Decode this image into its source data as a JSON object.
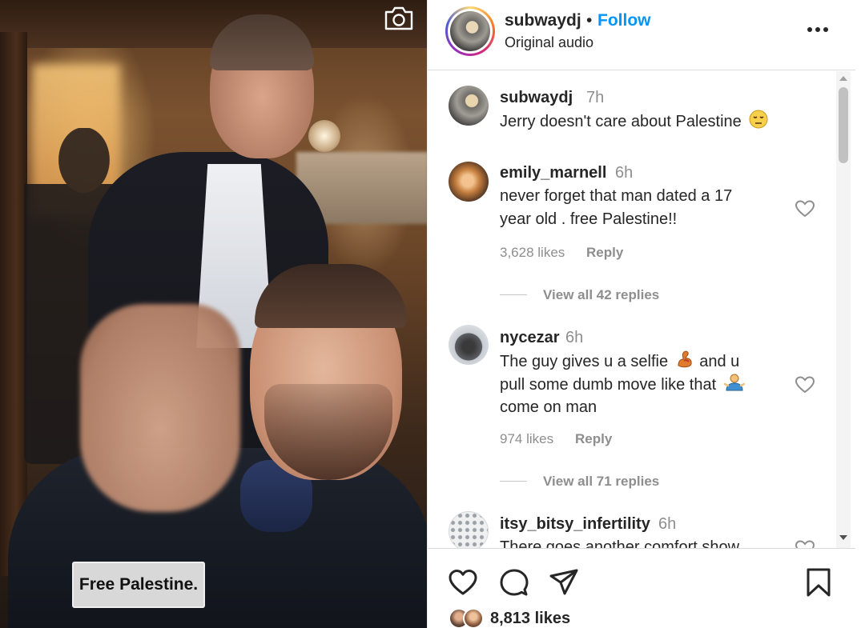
{
  "media": {
    "caption_overlay": "Free Palestine.",
    "icons": {
      "camera": "camera-icon"
    }
  },
  "header": {
    "username": "subwaydj",
    "separator": "•",
    "follow_label": "Follow",
    "audio_label": "Original audio",
    "icons": {
      "more": "more-horizontal-icon"
    }
  },
  "comments": [
    {
      "username": "subwaydj",
      "time": "7h",
      "lines": [
        "Jerry doesn't care about Palestine"
      ],
      "emoji": "downcast-face-icon"
    },
    {
      "username": "emily_marnell",
      "time": "6h",
      "lines": [
        "never forget that man dated a 17",
        "year old . free Palestine!!"
      ],
      "likes": "3,628 likes",
      "reply_label": "Reply",
      "view_replies": "View all 42 replies"
    },
    {
      "username": "nycezar",
      "time": "6h",
      "lines": [
        "The guy gives u a selfie",
        "and u",
        "pull some dumb move like that",
        "come on man"
      ],
      "likes": "974 likes",
      "reply_label": "Reply",
      "view_replies": "View all 71 replies"
    },
    {
      "username": "itsy_bitsy_infertility",
      "time": "6h",
      "lines": [
        "There goes another comfort show"
      ]
    }
  ],
  "actions": {
    "icons": [
      "heart-icon",
      "comment-icon",
      "share-icon",
      "bookmark-icon"
    ],
    "likes_count": "8,813 likes"
  }
}
